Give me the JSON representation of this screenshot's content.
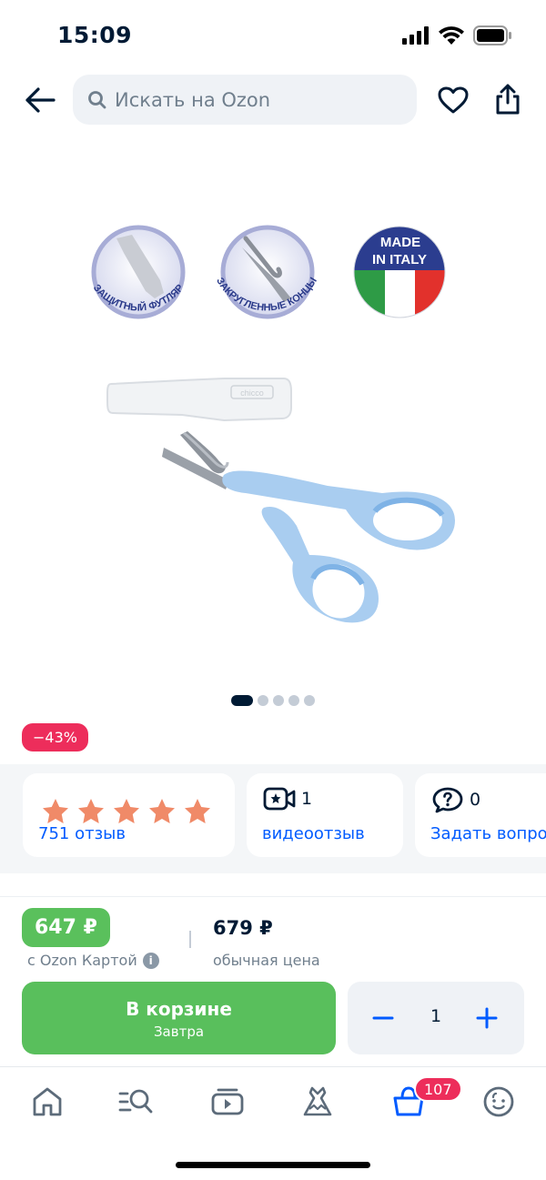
{
  "status_bar": {
    "time": "15:09"
  },
  "header": {
    "search_placeholder": "Искать на Ozon"
  },
  "gallery": {
    "badges": [
      {
        "text": "ЗАЩИТНЫЙ ФУТЛЯР"
      },
      {
        "text": "ЗАКРУГЛЕННЫЕ КОНЦЫ"
      }
    ],
    "made_in": {
      "line1": "MADE",
      "line2": "IN ITALY"
    },
    "case_logo": "chicco",
    "page_count": 5,
    "active_page": 1
  },
  "discount": "−43%",
  "cards": {
    "rating": {
      "stars": 5,
      "reviews": "751 отзыв"
    },
    "video": {
      "count": "1",
      "label": "видеоотзыв"
    },
    "questions": {
      "count": "0",
      "label": "Задать вопрос"
    }
  },
  "price": {
    "ozon_price": "647 ₽",
    "ozon_caption": "с Ozon Картой",
    "info": "i",
    "regular_price": "679 ₽",
    "regular_caption": "обычная цена"
  },
  "cart": {
    "button_label": "В корзине",
    "button_sub": "Завтра",
    "quantity": "1"
  },
  "bottom_nav": {
    "items": [
      "home-icon",
      "catalog-search-icon",
      "video-icon",
      "fashion-icon",
      "cart-icon",
      "profile-icon"
    ],
    "cart_badge": "107"
  },
  "colors": {
    "accent": "#005bff",
    "green": "#59bf5c",
    "discount": "#ed2d5b",
    "star": "#f08a68",
    "scissors": "#a9cdf0"
  }
}
